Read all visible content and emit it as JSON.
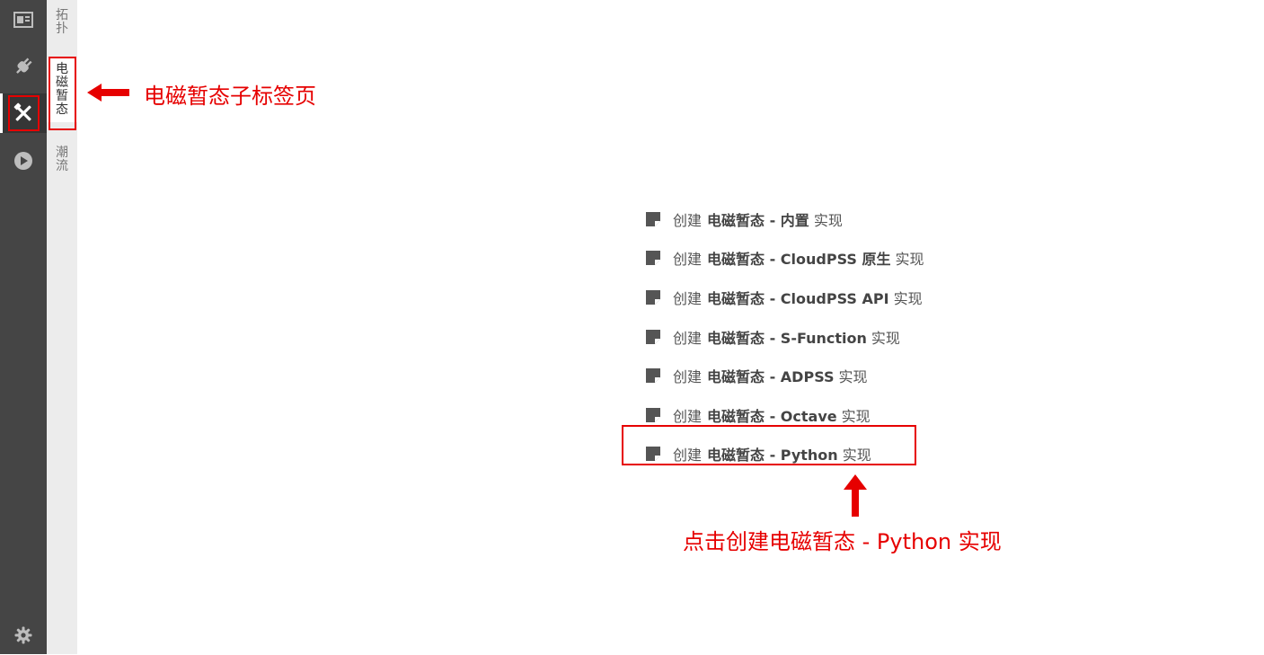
{
  "sidebar": {
    "icons": [
      {
        "name": "layout-icon",
        "active": false
      },
      {
        "name": "plug-icon",
        "active": false
      },
      {
        "name": "tools-icon",
        "active": true
      },
      {
        "name": "play-icon",
        "active": false
      }
    ],
    "settings_icon": "gear-icon"
  },
  "subtabs": [
    {
      "label": "拓扑",
      "active": false
    },
    {
      "label": "电磁暂态",
      "active": true
    },
    {
      "label": "潮流",
      "active": false
    }
  ],
  "actions": [
    {
      "prefix": "创建",
      "name": "电磁暂态 - 内置",
      "suffix": "实现"
    },
    {
      "prefix": "创建",
      "name": "电磁暂态 - CloudPSS 原生",
      "suffix": "实现"
    },
    {
      "prefix": "创建",
      "name": "电磁暂态 - CloudPSS API",
      "suffix": "实现"
    },
    {
      "prefix": "创建",
      "name": "电磁暂态 - S-Function",
      "suffix": "实现"
    },
    {
      "prefix": "创建",
      "name": "电磁暂态 - ADPSS",
      "suffix": "实现"
    },
    {
      "prefix": "创建",
      "name": "电磁暂态 - Octave",
      "suffix": "实现"
    },
    {
      "prefix": "创建",
      "name": "电磁暂态 - Python",
      "suffix": "实现"
    }
  ],
  "annotations": {
    "subtab_label": "电磁暂态子标签页",
    "action_label": "点击创建电磁暂态 - Python 实现",
    "color": "#e60000"
  },
  "colors": {
    "iconbar_bg": "#454545",
    "subtab_bg": "#ececec",
    "icon_color": "#bdbdbd"
  }
}
